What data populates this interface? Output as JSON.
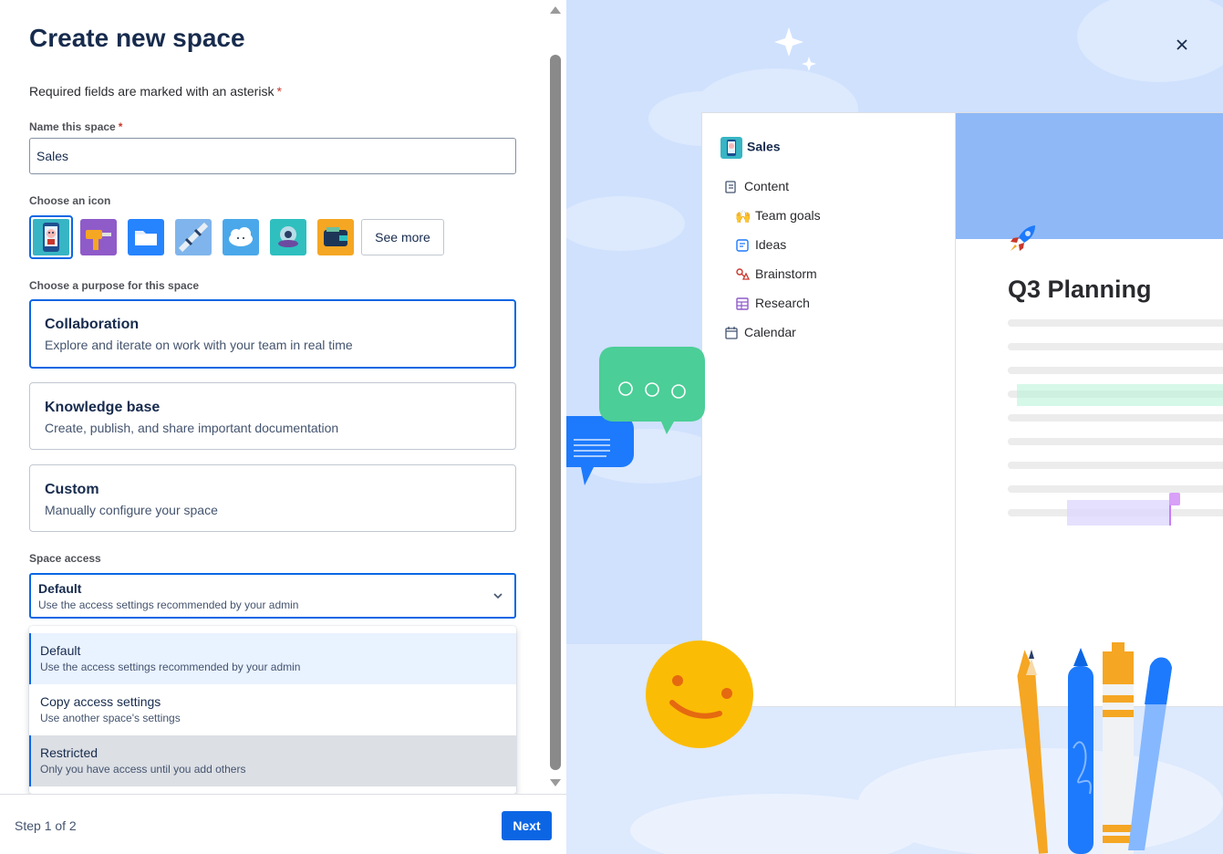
{
  "form": {
    "title": "Create new space",
    "required_note": "Required fields are marked with an asterisk",
    "asterisk": "*",
    "name_label": "Name this space",
    "name_value": "Sales",
    "icon_label": "Choose an icon",
    "icons": [
      "phone-robot-icon",
      "drill-icon",
      "folder-icon",
      "satellite-icon",
      "cloud-icon",
      "ufo-icon",
      "wallet-icon"
    ],
    "see_more": "See more",
    "purpose_label": "Choose a purpose for this space",
    "purposes": [
      {
        "title": "Collaboration",
        "desc": "Explore and iterate on work with your team in real time"
      },
      {
        "title": "Knowledge base",
        "desc": "Create, publish, and share important documentation"
      },
      {
        "title": "Custom",
        "desc": "Manually configure your space"
      }
    ],
    "access_label": "Space access",
    "access_selected": {
      "title": "Default",
      "desc": "Use the access settings recommended by your admin"
    },
    "access_options": [
      {
        "title": "Default",
        "desc": "Use the access settings recommended by your admin"
      },
      {
        "title": "Copy access settings",
        "desc": "Use another space's settings"
      },
      {
        "title": "Restricted",
        "desc": "Only you have access until you add others"
      }
    ]
  },
  "footer": {
    "step": "Step 1 of 2",
    "next": "Next"
  },
  "preview": {
    "space_name": "Sales",
    "nav": [
      {
        "label": "Content",
        "icon": "pages-icon"
      },
      {
        "label": "Team goals",
        "icon": "raised-hands-icon"
      },
      {
        "label": "Ideas",
        "icon": "page-icon"
      },
      {
        "label": "Brainstorm",
        "icon": "whiteboard-icon"
      },
      {
        "label": "Research",
        "icon": "database-icon"
      },
      {
        "label": "Calendar",
        "icon": "calendar-icon"
      }
    ],
    "page_title": "Q3 Planning"
  },
  "colors": {
    "accent": "#0c66e4",
    "preview_bg": "#cfe1fd",
    "danger": "#c9372c"
  }
}
